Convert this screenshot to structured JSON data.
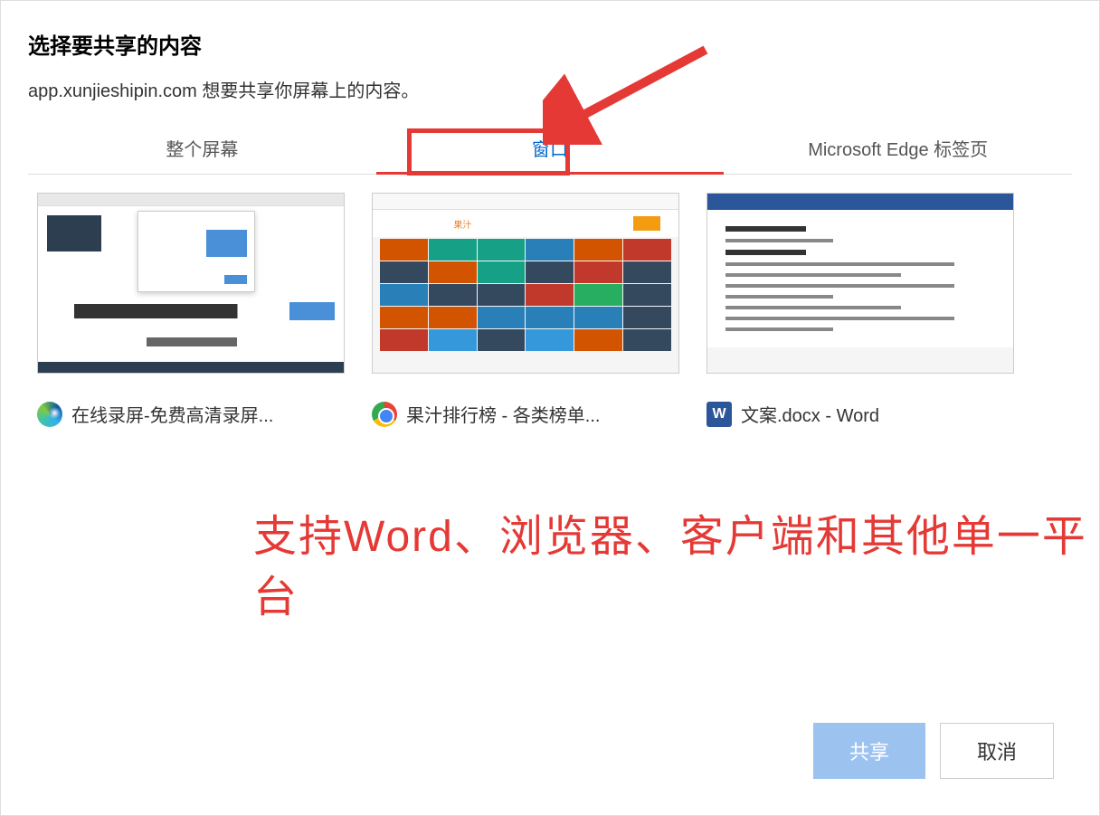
{
  "dialog": {
    "title": "选择要共享的内容",
    "subtitle": "app.xunjieshipin.com 想要共享你屏幕上的内容。"
  },
  "tabs": [
    {
      "label": "整个屏幕",
      "active": false
    },
    {
      "label": "窗口",
      "active": true
    },
    {
      "label": "Microsoft Edge 标签页",
      "active": false
    }
  ],
  "windows": [
    {
      "icon": "edge-icon",
      "label": "在线录屏-免费高清录屏..."
    },
    {
      "icon": "chrome-icon",
      "label": "果汁排行榜 - 各类榜单..."
    },
    {
      "icon": "word-icon",
      "label": "文案.docx - Word"
    }
  ],
  "annotation": {
    "text": "支持Word、浏览器、客户端和其他单一平台"
  },
  "footer": {
    "share": "共享",
    "cancel": "取消"
  }
}
